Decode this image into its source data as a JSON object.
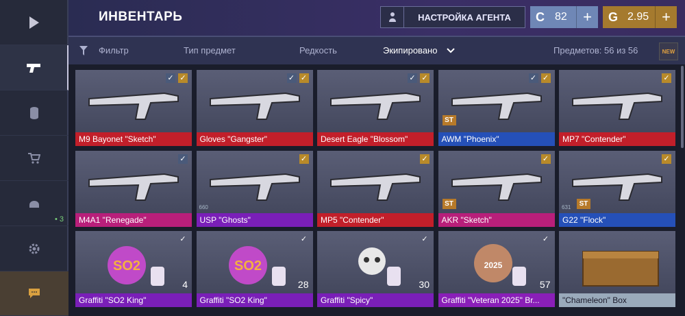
{
  "header": {
    "title": "ИНВЕНТАРЬ",
    "agent_button": "НАСТРОЙКА АГЕНТА"
  },
  "currency": {
    "credits": "82",
    "gold": "2.95"
  },
  "sidebar": {
    "count_badge": "• 3"
  },
  "filters": {
    "filter": "Фильтр",
    "type": "Тип предмет",
    "rarity": "Редкость",
    "equipped": "Экипировано",
    "count": "Предметов: 56 из 56",
    "new_badge": "NEW"
  },
  "items": [
    {
      "name": "M9 Bayonet \"Sketch\"",
      "color": "#c21f2a",
      "checks": [
        "blue",
        "gold"
      ]
    },
    {
      "name": "Gloves \"Gangster\"",
      "color": "#c21f2a",
      "checks": [
        "blue",
        "gold"
      ]
    },
    {
      "name": "Desert Eagle \"Blossom\"",
      "color": "#c21f2a",
      "checks": [
        "blue",
        "gold"
      ]
    },
    {
      "name": "AWM \"Phoenix\"",
      "color": "#2550b8",
      "checks": [
        "blue",
        "gold"
      ],
      "st": "ST"
    },
    {
      "name": "MP7 \"Contender\"",
      "color": "#c21f2a",
      "checks": [
        "gold"
      ]
    },
    {
      "name": "M4A1 \"Renegade\"",
      "color": "#b81f7a",
      "checks": [
        "blue"
      ]
    },
    {
      "name": "USP \"Ghosts\"",
      "color": "#7a1fb8",
      "checks": [
        "gold"
      ],
      "level": "660"
    },
    {
      "name": "MP5 \"Contender\"",
      "color": "#c21f2a",
      "checks": [
        "gold"
      ]
    },
    {
      "name": "AKR \"Sketch\"",
      "color": "#b81f7a",
      "checks": [
        "gold"
      ],
      "st": "ST"
    },
    {
      "name": "G22 \"Flock\"",
      "color": "#2550b8",
      "checks": [
        "gold"
      ],
      "st": "ST",
      "level": "631"
    },
    {
      "name": "Graffiti \"SO2 King\"",
      "color": "#7a1fb8",
      "checks": [
        "white"
      ],
      "qty": "4"
    },
    {
      "name": "Graffiti \"SO2 King\"",
      "color": "#7a1fb8",
      "checks": [
        "white"
      ],
      "qty": "28"
    },
    {
      "name": "Graffiti \"Spicy\"",
      "color": "#7a1fb8",
      "checks": [
        "white"
      ],
      "qty": "30"
    },
    {
      "name": "Graffiti \"Veteran 2025\" Br...",
      "color": "#8a1fb8",
      "checks": [
        "white"
      ],
      "qty": "57"
    },
    {
      "name": "\"Chameleon\" Box",
      "color": "#9aaabb",
      "checks": []
    }
  ]
}
